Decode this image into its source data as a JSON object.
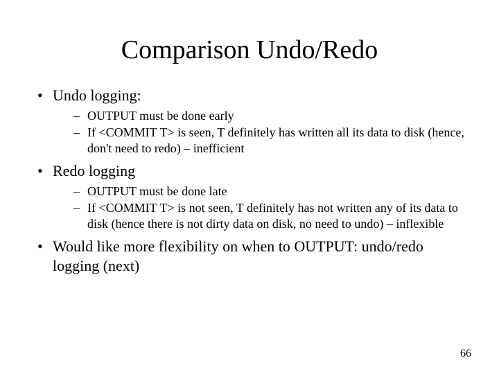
{
  "title": "Comparison Undo/Redo",
  "bullets": [
    {
      "text": "Undo logging:",
      "sub": [
        "OUTPUT must be done early",
        "If <COMMIT T> is seen, T definitely has written all its data to disk (hence, don't need to redo) – inefficient"
      ]
    },
    {
      "text": "Redo logging",
      "sub": [
        "OUTPUT must be done late",
        "If <COMMIT T> is not seen, T definitely has not written any of its data to disk (hence there is not dirty data on disk, no need to undo) – inflexible"
      ]
    },
    {
      "text": "Would like more flexibility on when to OUTPUT: undo/redo logging (next)",
      "sub": []
    }
  ],
  "page_number": "66"
}
